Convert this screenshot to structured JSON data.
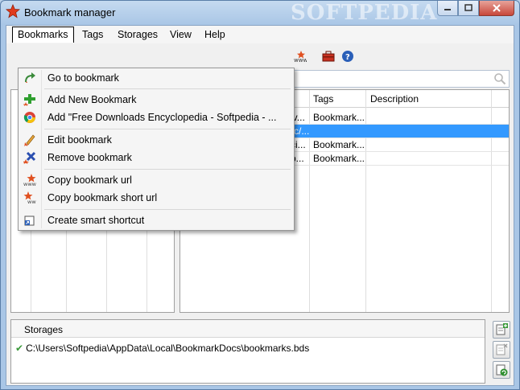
{
  "window": {
    "title": "Bookmark manager",
    "watermark": "SOFTPEDIA"
  },
  "menubar": {
    "items": [
      "Bookmarks",
      "Tags",
      "Storages",
      "View",
      "Help"
    ]
  },
  "search": {
    "value": "",
    "placeholder": ""
  },
  "bookmarks_table": {
    "columns": [
      "Tags",
      "Description"
    ],
    "rows": [
      {
        "name_tail": "iv...",
        "tags": "Bookmark...",
        "description": ""
      },
      {
        "name_tail": "rc/...",
        "tags": "",
        "description": ""
      },
      {
        "name_tail": "ci...",
        "tags": "Bookmark...",
        "description": ""
      },
      {
        "name_tail": "p...",
        "tags": "Bookmark...",
        "description": ""
      }
    ]
  },
  "storages": {
    "header": "Storages",
    "path": "C:\\Users\\Softpedia\\AppData\\Local\\BookmarkDocs\\bookmarks.bds"
  },
  "bookmarks_menu": {
    "items": [
      {
        "label": "Go to bookmark",
        "icon": "go-arrow-icon"
      },
      {
        "label": "Add New Bookmark",
        "icon": "add-icon"
      },
      {
        "label": "Add \"Free Downloads Encyclopedia - Softpedia - ...",
        "icon": "chrome-icon"
      },
      {
        "label": "Edit bookmark",
        "icon": "edit-pencil-icon"
      },
      {
        "label": "Remove bookmark",
        "icon": "remove-icon"
      },
      {
        "label": "Copy bookmark url",
        "icon": "copy-url-icon"
      },
      {
        "label": "Copy bookmark short url",
        "icon": "copy-short-url-icon"
      },
      {
        "label": "Create smart shortcut",
        "icon": "shortcut-icon"
      }
    ]
  },
  "colors": {
    "selection": "#3399ff",
    "titlebar": "#a9c6e6",
    "close": "#c8473a"
  }
}
